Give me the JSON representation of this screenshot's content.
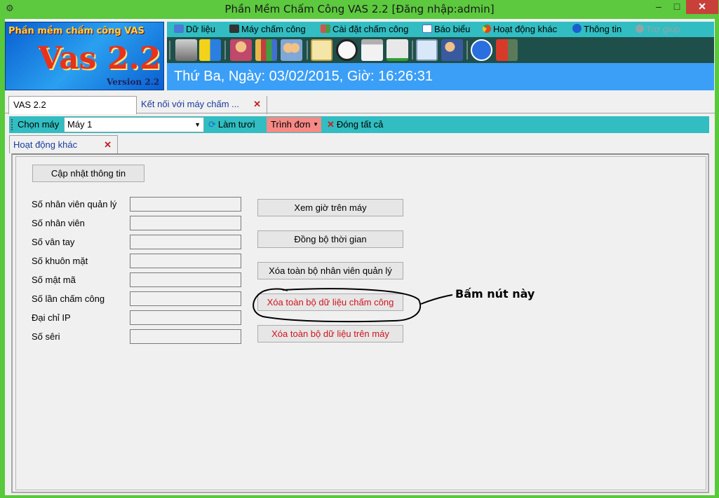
{
  "window": {
    "title": "Phần Mềm Chấm Công VAS 2.2 [Đăng nhập:admin]",
    "minimize": "–",
    "maximize": "□",
    "close": "✕"
  },
  "logo": {
    "top_text": "Phần mềm chấm công VAS",
    "main_text": "Vas 2.2",
    "version_text": "Version 2.2"
  },
  "menu": {
    "items": [
      {
        "label": "Dữ liệu",
        "icon": "database-icon",
        "color": "#4a7bd6"
      },
      {
        "label": "Máy chấm công",
        "icon": "device-icon",
        "color": "#333333"
      },
      {
        "label": "Cài đặt chấm công",
        "icon": "settings-grid-icon",
        "color": "#d6524a"
      },
      {
        "label": "Báo biểu",
        "icon": "report-icon",
        "color": "#5a6ad6"
      },
      {
        "label": "Hoạt động khác",
        "icon": "pie-icon",
        "color": "#e4451e"
      },
      {
        "label": "Thông tin",
        "icon": "info-icon",
        "color": "#1a5fd0"
      },
      {
        "label": "Trợ giúp",
        "icon": "help-icon",
        "color": "#8fa6a6"
      }
    ]
  },
  "toolbar": {
    "buttons": [
      {
        "name": "device-tool-icon",
        "color": "#c8c8c8"
      },
      {
        "name": "sync-arrows-icon",
        "color": "#f3d21a"
      },
      {
        "name": "employee-icon",
        "color": "#f2c186"
      },
      {
        "name": "chart-bars-icon",
        "color": "#e8b84a"
      },
      {
        "name": "group-users-icon",
        "color": "#7fa8d8"
      },
      {
        "name": "edit-note-icon",
        "color": "#f4e6a8"
      },
      {
        "name": "clock-icon",
        "color": "#f2f2f2"
      },
      {
        "name": "calendar-icon",
        "color": "#e8e8e8"
      },
      {
        "name": "checklist-icon",
        "color": "#e0e0e0"
      },
      {
        "name": "search-doc-icon",
        "color": "#a8c8e8"
      },
      {
        "name": "user-info-icon",
        "color": "#5a88d0"
      },
      {
        "name": "info-circle-icon",
        "color": "#2a6fe0"
      },
      {
        "name": "exit-icon",
        "color": "#d83a2a"
      }
    ]
  },
  "datebar": {
    "text": "Thứ Ba, Ngày: 03/02/2015, Giờ: 16:26:31"
  },
  "doc_tabs": [
    {
      "label": "VAS 2.2"
    },
    {
      "label": "Kết nối với máy chấm ...",
      "close": "✕"
    }
  ],
  "subtoolbar": {
    "chon_label": "Chọn máy",
    "machine_value": "Máy 1",
    "lam_tuoi": "Làm tươi",
    "trinh_don": "Trình đơn",
    "dong_tat_ca": "Đóng tất cả"
  },
  "inner_tab": {
    "label": "Hoạt động khác",
    "close": "✕"
  },
  "panel": {
    "update_button": "Cập nhật thông tin",
    "fields": [
      {
        "label": "Số nhân viên quản lý",
        "value": ""
      },
      {
        "label": "Số nhân viên",
        "value": ""
      },
      {
        "label": "Số vân tay",
        "value": ""
      },
      {
        "label": "Số khuôn mặt",
        "value": ""
      },
      {
        "label": "Số mật mã",
        "value": ""
      },
      {
        "label": "Số lần chấm công",
        "value": ""
      },
      {
        "label": "Đại chỉ IP",
        "value": ""
      },
      {
        "label": "Số sêri",
        "value": ""
      }
    ],
    "actions": {
      "xem_gio": "Xem giờ trên máy",
      "dong_bo": "Đồng bộ thời gian",
      "xoa_nv_ql": "Xóa toàn bộ nhân viên quản lý",
      "xoa_cham_cong": "Xóa toàn bộ dữ liệu chấm công",
      "xoa_tren_may": "Xóa toàn bộ dữ liệu trên máy"
    }
  },
  "annotation": {
    "text": "Bấm nút này"
  }
}
